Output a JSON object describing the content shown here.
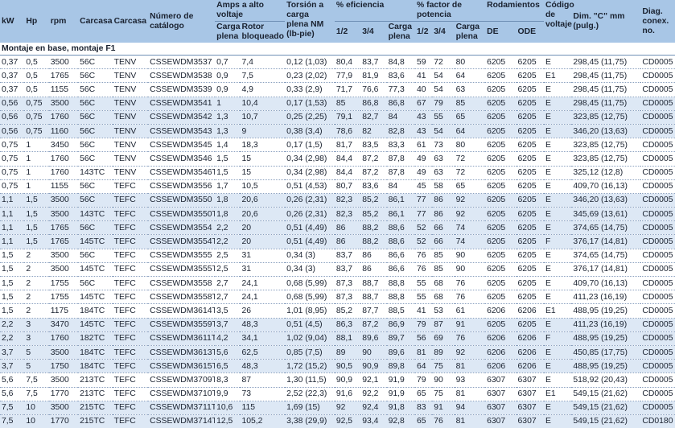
{
  "headers": {
    "kw": "kW",
    "hp": "Hp",
    "rpm": "rpm",
    "carcasa1": "Carcasa",
    "carcasa2": "Carcasa",
    "catalogo": "Número de catálogo",
    "amps": "Amps a alto voltaje",
    "amps_carga": "Carga plena",
    "amps_rotor": "Rotor bloqueado",
    "torsion": "Torsión a carga plena NM (lb-pie)",
    "eficiencia": "% eficiencia",
    "ef_12": "1/2",
    "ef_34": "3/4",
    "ef_carga": "Carga plena",
    "factor": "% factor de potencia",
    "fp_12": "1/2",
    "fp_34": "3/4",
    "fp_carga": "Carga plena",
    "rodamientos": "Rodamientos",
    "de": "DE",
    "ode": "ODE",
    "codigo": "Código de voltaje",
    "dim": "Dim. \"C\" mm (pulg.)",
    "diag": "Diag. conex. no."
  },
  "section_title": "Montaje en base, montaje F1",
  "rows": [
    {
      "kw": "0,37",
      "hp": "0,5",
      "rpm": "3500",
      "c1": "56C",
      "c2": "TENV",
      "cat": "CSSEWDM3537",
      "ac": "0,7",
      "ar": "7,4",
      "tor": "0,12 (1,03)",
      "e12": "80,4",
      "e34": "83,7",
      "ec": "84,8",
      "f12": "59",
      "f34": "72",
      "fc": "80",
      "de": "6205",
      "ode": "6205",
      "cod": "E",
      "dim": "298,45 (11,75)",
      "diag": "CD0005"
    },
    {
      "kw": "0,37",
      "hp": "0,5",
      "rpm": "1765",
      "c1": "56C",
      "c2": "TENV",
      "cat": "CSSEWDM3538",
      "ac": "0,9",
      "ar": "7,5",
      "tor": "0,23 (2,02)",
      "e12": "77,9",
      "e34": "81,9",
      "ec": "83,6",
      "f12": "41",
      "f34": "54",
      "fc": "64",
      "de": "6205",
      "ode": "6205",
      "cod": "E1",
      "dim": "298,45 (11,75)",
      "diag": "CD0005"
    },
    {
      "kw": "0,37",
      "hp": "0,5",
      "rpm": "1155",
      "c1": "56C",
      "c2": "TENV",
      "cat": "CSSEWDM3539",
      "ac": "0,9",
      "ar": "4,9",
      "tor": "0,33 (2,9)",
      "e12": "71,7",
      "e34": "76,6",
      "ec": "77,3",
      "f12": "40",
      "f34": "54",
      "fc": "63",
      "de": "6205",
      "ode": "6205",
      "cod": "E",
      "dim": "298,45 (11,75)",
      "diag": "CD0005"
    },
    {
      "kw": "0,56",
      "hp": "0,75",
      "rpm": "3500",
      "c1": "56C",
      "c2": "TENV",
      "cat": "CSSEWDM3541",
      "ac": "1",
      "ar": "10,4",
      "tor": "0,17 (1,53)",
      "e12": "85",
      "e34": "86,8",
      "ec": "86,8",
      "f12": "67",
      "f34": "79",
      "fc": "85",
      "de": "6205",
      "ode": "6205",
      "cod": "E",
      "dim": "298,45 (11,75)",
      "diag": "CD0005"
    },
    {
      "kw": "0,56",
      "hp": "0,75",
      "rpm": "1760",
      "c1": "56C",
      "c2": "TENV",
      "cat": "CSSEWDM3542",
      "ac": "1,3",
      "ar": "10,7",
      "tor": "0,25 (2,25)",
      "e12": "79,1",
      "e34": "82,7",
      "ec": "84",
      "f12": "43",
      "f34": "55",
      "fc": "65",
      "de": "6205",
      "ode": "6205",
      "cod": "E",
      "dim": "323,85 (12,75)",
      "diag": "CD0005"
    },
    {
      "kw": "0,56",
      "hp": "0,75",
      "rpm": "1160",
      "c1": "56C",
      "c2": "TENV",
      "cat": "CSSEWDM3543",
      "ac": "1,3",
      "ar": "9",
      "tor": "0,38 (3,4)",
      "e12": "78,6",
      "e34": "82",
      "ec": "82,8",
      "f12": "43",
      "f34": "54",
      "fc": "64",
      "de": "6205",
      "ode": "6205",
      "cod": "E",
      "dim": "346,20 (13,63)",
      "diag": "CD0005"
    },
    {
      "kw": "0,75",
      "hp": "1",
      "rpm": "3450",
      "c1": "56C",
      "c2": "TENV",
      "cat": "CSSEWDM3545",
      "ac": "1,4",
      "ar": "18,3",
      "tor": "0,17 (1,5)",
      "e12": "81,7",
      "e34": "83,5",
      "ec": "83,3",
      "f12": "61",
      "f34": "73",
      "fc": "80",
      "de": "6205",
      "ode": "6205",
      "cod": "E",
      "dim": "323,85 (12,75)",
      "diag": "CD0005"
    },
    {
      "kw": "0,75",
      "hp": "1",
      "rpm": "1760",
      "c1": "56C",
      "c2": "TENV",
      "cat": "CSSEWDM3546",
      "ac": "1,5",
      "ar": "15",
      "tor": "0,34 (2,98)",
      "e12": "84,4",
      "e34": "87,2",
      "ec": "87,8",
      "f12": "49",
      "f34": "63",
      "fc": "72",
      "de": "6205",
      "ode": "6205",
      "cod": "E",
      "dim": "323,85 (12,75)",
      "diag": "CD0005"
    },
    {
      "kw": "0,75",
      "hp": "1",
      "rpm": "1760",
      "c1": "143TC",
      "c2": "TENV",
      "cat": "CSSEWDM3546T",
      "ac": "1,5",
      "ar": "15",
      "tor": "0,34 (2,98)",
      "e12": "84,4",
      "e34": "87,2",
      "ec": "87,8",
      "f12": "49",
      "f34": "63",
      "fc": "72",
      "de": "6205",
      "ode": "6205",
      "cod": "E",
      "dim": "325,12 (12,8)",
      "diag": "CD0005"
    },
    {
      "kw": "0,75",
      "hp": "1",
      "rpm": "1155",
      "c1": "56C",
      "c2": "TEFC",
      "cat": "CSSEWDM3556",
      "ac": "1,7",
      "ar": "10,5",
      "tor": "0,51 (4,53)",
      "e12": "80,7",
      "e34": "83,6",
      "ec": "84",
      "f12": "45",
      "f34": "58",
      "fc": "65",
      "de": "6205",
      "ode": "6205",
      "cod": "E",
      "dim": "409,70 (16,13)",
      "diag": "CD0005"
    },
    {
      "kw": "1,1",
      "hp": "1,5",
      "rpm": "3500",
      "c1": "56C",
      "c2": "TEFC",
      "cat": "CSSEWDM3550",
      "ac": "1,8",
      "ar": "20,6",
      "tor": "0,26 (2,31)",
      "e12": "82,3",
      "e34": "85,2",
      "ec": "86,1",
      "f12": "77",
      "f34": "86",
      "fc": "92",
      "de": "6205",
      "ode": "6205",
      "cod": "E",
      "dim": "346,20 (13,63)",
      "diag": "CD0005"
    },
    {
      "kw": "1,1",
      "hp": "1,5",
      "rpm": "3500",
      "c1": "143TC",
      "c2": "TEFC",
      "cat": "CSSEWDM3550T",
      "ac": "1,8",
      "ar": "20,6",
      "tor": "0,26 (2,31)",
      "e12": "82,3",
      "e34": "85,2",
      "ec": "86,1",
      "f12": "77",
      "f34": "86",
      "fc": "92",
      "de": "6205",
      "ode": "6205",
      "cod": "E",
      "dim": "345,69 (13,61)",
      "diag": "CD0005"
    },
    {
      "kw": "1,1",
      "hp": "1,5",
      "rpm": "1765",
      "c1": "56C",
      "c2": "TEFC",
      "cat": "CSSEWDM3554",
      "ac": "2,2",
      "ar": "20",
      "tor": "0,51 (4,49)",
      "e12": "86",
      "e34": "88,2",
      "ec": "88,6",
      "f12": "52",
      "f34": "66",
      "fc": "74",
      "de": "6205",
      "ode": "6205",
      "cod": "E",
      "dim": "374,65 (14,75)",
      "diag": "CD0005"
    },
    {
      "kw": "1,1",
      "hp": "1,5",
      "rpm": "1765",
      "c1": "145TC",
      "c2": "TEFC",
      "cat": "CSSEWDM3554T",
      "ac": "2,2",
      "ar": "20",
      "tor": "0,51 (4,49)",
      "e12": "86",
      "e34": "88,2",
      "ec": "88,6",
      "f12": "52",
      "f34": "66",
      "fc": "74",
      "de": "6205",
      "ode": "6205",
      "cod": "F",
      "dim": "376,17 (14,81)",
      "diag": "CD0005"
    },
    {
      "kw": "1,5",
      "hp": "2",
      "rpm": "3500",
      "c1": "56C",
      "c2": "TEFC",
      "cat": "CSSEWDM3555",
      "ac": "2,5",
      "ar": "31",
      "tor": "0,34 (3)",
      "e12": "83,7",
      "e34": "86",
      "ec": "86,6",
      "f12": "76",
      "f34": "85",
      "fc": "90",
      "de": "6205",
      "ode": "6205",
      "cod": "E",
      "dim": "374,65 (14,75)",
      "diag": "CD0005"
    },
    {
      "kw": "1,5",
      "hp": "2",
      "rpm": "3500",
      "c1": "145TC",
      "c2": "TEFC",
      "cat": "CSSEWDM3555T",
      "ac": "2,5",
      "ar": "31",
      "tor": "0,34 (3)",
      "e12": "83,7",
      "e34": "86",
      "ec": "86,6",
      "f12": "76",
      "f34": "85",
      "fc": "90",
      "de": "6205",
      "ode": "6205",
      "cod": "E",
      "dim": "376,17 (14,81)",
      "diag": "CD0005"
    },
    {
      "kw": "1,5",
      "hp": "2",
      "rpm": "1755",
      "c1": "56C",
      "c2": "TEFC",
      "cat": "CSSEWDM3558",
      "ac": "2,7",
      "ar": "24,1",
      "tor": "0,68 (5,99)",
      "e12": "87,3",
      "e34": "88,7",
      "ec": "88,8",
      "f12": "55",
      "f34": "68",
      "fc": "76",
      "de": "6205",
      "ode": "6205",
      "cod": "E",
      "dim": "409,70 (16,13)",
      "diag": "CD0005"
    },
    {
      "kw": "1,5",
      "hp": "2",
      "rpm": "1755",
      "c1": "145TC",
      "c2": "TEFC",
      "cat": "CSSEWDM3558T",
      "ac": "2,7",
      "ar": "24,1",
      "tor": "0,68 (5,99)",
      "e12": "87,3",
      "e34": "88,7",
      "ec": "88,8",
      "f12": "55",
      "f34": "68",
      "fc": "76",
      "de": "6205",
      "ode": "6205",
      "cod": "E",
      "dim": "411,23 (16,19)",
      "diag": "CD0005"
    },
    {
      "kw": "1,5",
      "hp": "2",
      "rpm": "1175",
      "c1": "184TC",
      "c2": "TEFC",
      "cat": "CSSEWDM3614T",
      "ac": "3,5",
      "ar": "26",
      "tor": "1,01 (8,95)",
      "e12": "85,2",
      "e34": "87,7",
      "ec": "88,5",
      "f12": "41",
      "f34": "53",
      "fc": "61",
      "de": "6206",
      "ode": "6206",
      "cod": "E1",
      "dim": "488,95 (19,25)",
      "diag": "CD0005"
    },
    {
      "kw": "2,2",
      "hp": "3",
      "rpm": "3470",
      "c1": "145TC",
      "c2": "TEFC",
      "cat": "CSSEWDM3559T",
      "ac": "3,7",
      "ar": "48,3",
      "tor": "0,51 (4,5)",
      "e12": "86,3",
      "e34": "87,2",
      "ec": "86,9",
      "f12": "79",
      "f34": "87",
      "fc": "91",
      "de": "6205",
      "ode": "6205",
      "cod": "E",
      "dim": "411,23 (16,19)",
      "diag": "CD0005"
    },
    {
      "kw": "2,2",
      "hp": "3",
      "rpm": "1760",
      "c1": "182TC",
      "c2": "TEFC",
      "cat": "CSSEWDM3611T",
      "ac": "4,2",
      "ar": "34,1",
      "tor": "1,02 (9,04)",
      "e12": "88,1",
      "e34": "89,6",
      "ec": "89,7",
      "f12": "56",
      "f34": "69",
      "fc": "76",
      "de": "6206",
      "ode": "6206",
      "cod": "F",
      "dim": "488,95 (19,25)",
      "diag": "CD0005"
    },
    {
      "kw": "3,7",
      "hp": "5",
      "rpm": "3500",
      "c1": "184TC",
      "c2": "TEFC",
      "cat": "CSSEWDM3613T",
      "ac": "5,6",
      "ar": "62,5",
      "tor": "0,85 (7,5)",
      "e12": "89",
      "e34": "90",
      "ec": "89,6",
      "f12": "81",
      "f34": "89",
      "fc": "92",
      "de": "6206",
      "ode": "6206",
      "cod": "E",
      "dim": "450,85 (17,75)",
      "diag": "CD0005"
    },
    {
      "kw": "3,7",
      "hp": "5",
      "rpm": "1750",
      "c1": "184TC",
      "c2": "TEFC",
      "cat": "CSSEWDM3615T",
      "ac": "6,5",
      "ar": "48,3",
      "tor": "1,72 (15,2)",
      "e12": "90,5",
      "e34": "90,9",
      "ec": "89,8",
      "f12": "64",
      "f34": "75",
      "fc": "81",
      "de": "6206",
      "ode": "6206",
      "cod": "E",
      "dim": "488,95 (19,25)",
      "diag": "CD0005"
    },
    {
      "kw": "5,6",
      "hp": "7,5",
      "rpm": "3500",
      "c1": "213TC",
      "c2": "TEFC",
      "cat": "CSSEWDM3709T",
      "ac": "8,3",
      "ar": "87",
      "tor": "1,30 (11,5)",
      "e12": "90,9",
      "e34": "92,1",
      "ec": "91,9",
      "f12": "79",
      "f34": "90",
      "fc": "93",
      "de": "6307",
      "ode": "6307",
      "cod": "E",
      "dim": "518,92 (20,43)",
      "diag": "CD0005"
    },
    {
      "kw": "5,6",
      "hp": "7,5",
      "rpm": "1770",
      "c1": "213TC",
      "c2": "TEFC",
      "cat": "CSSEWDM3710T",
      "ac": "9,9",
      "ar": "73",
      "tor": "2,52 (22,3)",
      "e12": "91,6",
      "e34": "92,2",
      "ec": "91,9",
      "f12": "65",
      "f34": "75",
      "fc": "81",
      "de": "6307",
      "ode": "6307",
      "cod": "E1",
      "dim": "549,15 (21,62)",
      "diag": "CD0005"
    },
    {
      "kw": "7,5",
      "hp": "10",
      "rpm": "3500",
      "c1": "215TC",
      "c2": "TEFC",
      "cat": "CSSEWDM3711T",
      "ac": "10,6",
      "ar": "115",
      "tor": "1,69 (15)",
      "e12": "92",
      "e34": "92,4",
      "ec": "91,8",
      "f12": "83",
      "f34": "91",
      "fc": "94",
      "de": "6307",
      "ode": "6307",
      "cod": "E",
      "dim": "549,15 (21,62)",
      "diag": "CD0005"
    },
    {
      "kw": "7,5",
      "hp": "10",
      "rpm": "1770",
      "c1": "215TC",
      "c2": "TEFC",
      "cat": "CSSEWDM3714T",
      "ac": "12,5",
      "ar": "105,2",
      "tor": "3,38 (29,9)",
      "e12": "92,5",
      "e34": "93,4",
      "ec": "92,8",
      "f12": "65",
      "f34": "76",
      "fc": "81",
      "de": "6307",
      "ode": "6307",
      "cod": "E",
      "dim": "549,15 (21,62)",
      "diag": "CD0180"
    }
  ],
  "colors": {
    "header_bg": "#a8c6e6",
    "shade_bg": "#dde8f5",
    "text": "#1a2230"
  }
}
